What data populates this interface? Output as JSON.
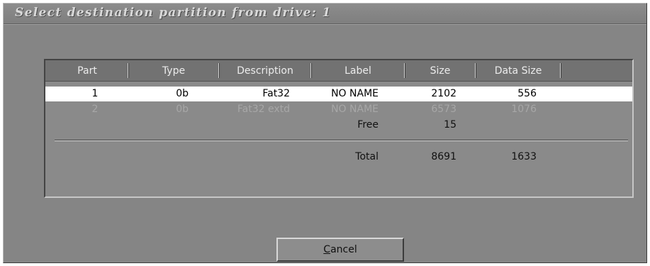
{
  "dialog": {
    "title": "Select destination partition from drive: 1"
  },
  "table": {
    "columns": [
      "Part",
      "Type",
      "Description",
      "Label",
      "Size",
      "Data Size"
    ],
    "rows": [
      {
        "part": "1",
        "type": "0b",
        "description": "Fat32",
        "label": "NO NAME",
        "size": "2102",
        "data_size": "556",
        "state": "selected"
      },
      {
        "part": "2",
        "type": "0b",
        "description": "Fat32 extd",
        "label": "NO NAME",
        "size": "6573",
        "data_size": "1076",
        "state": "disabled"
      },
      {
        "part": "",
        "type": "",
        "description": "",
        "label": "Free",
        "size": "15",
        "data_size": "",
        "state": "normal"
      }
    ],
    "total": {
      "label": "Total",
      "size": "8691",
      "data_size": "1633"
    }
  },
  "buttons": {
    "cancel": {
      "first_letter": "C",
      "rest": "ancel"
    }
  }
}
